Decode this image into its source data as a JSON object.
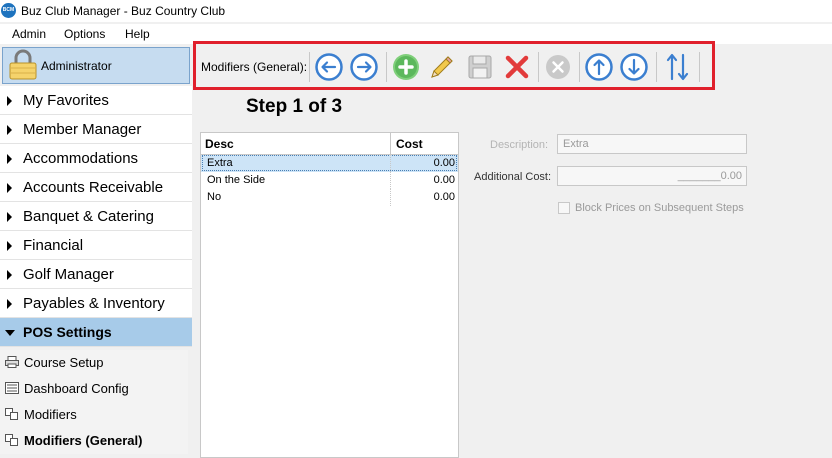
{
  "window": {
    "title": "Buz Club Manager - Buz Country Club",
    "app_icon_text": "BCM"
  },
  "menu": [
    "Admin",
    "Options",
    "Help"
  ],
  "sidebar": {
    "user": "Administrator",
    "nav": [
      {
        "label": "My Favorites"
      },
      {
        "label": "Member Manager"
      },
      {
        "label": "Accommodations"
      },
      {
        "label": "Accounts Receivable"
      },
      {
        "label": "Banquet & Catering"
      },
      {
        "label": "Financial"
      },
      {
        "label": "Golf Manager"
      },
      {
        "label": "Payables & Inventory"
      },
      {
        "label": "POS Settings"
      }
    ],
    "sub": [
      {
        "label": "Course Setup",
        "icon": "printer-icon"
      },
      {
        "label": "Dashboard Config",
        "icon": "dashboard-icon"
      },
      {
        "label": "Modifiers",
        "icon": "modifiers-icon"
      },
      {
        "label": "Modifiers (General)",
        "icon": "modifiers-icon"
      }
    ]
  },
  "toolbar": {
    "label": "Modifiers (General):",
    "buttons": [
      "previous",
      "next",
      "add",
      "edit",
      "save",
      "delete",
      "cancel",
      "move-up",
      "move-down",
      "sort"
    ]
  },
  "step_label": "Step 1 of 3",
  "grid": {
    "headers": [
      "Desc",
      "Cost"
    ],
    "rows": [
      {
        "desc": "Extra",
        "cost": "0.00"
      },
      {
        "desc": "On the Side",
        "cost": "0.00"
      },
      {
        "desc": "No",
        "cost": "0.00"
      }
    ]
  },
  "form": {
    "description_label": "Description:",
    "description_value": "Extra",
    "cost_label": "Additional Cost:",
    "cost_value": "_______0.00",
    "block_prices_label": "Block Prices on Subsequent Steps",
    "block_prices_checked": false
  },
  "colors": {
    "highlight_border": "#e0202c",
    "active_nav": "#a7cbe9",
    "button_blue": "#3b7fd0",
    "button_green": "#5cb85c",
    "delete_red": "#e23b3b"
  }
}
